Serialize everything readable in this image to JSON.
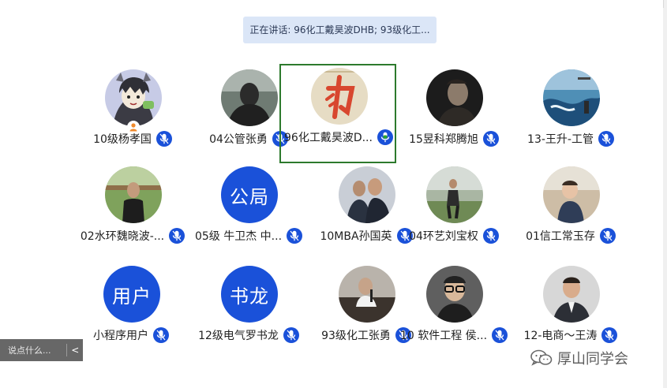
{
  "banner": {
    "text": "正在讲话: 96化工戴昊波DHB; 93级化工..."
  },
  "participants": [
    {
      "name": "10级杨孝国",
      "avatar": "cartoon",
      "host": true
    },
    {
      "name": "04公管张勇",
      "avatar": "photo-dark"
    },
    {
      "name": "96化工戴昊波D...",
      "avatar": "calligraphy",
      "speaking": true
    },
    {
      "name": "15昱科郑腾旭",
      "avatar": "photo-man"
    },
    {
      "name": "13-王升-工管",
      "avatar": "photo-sea"
    },
    {
      "name": "02水环魏晓波-...",
      "avatar": "photo-field"
    },
    {
      "name": "05级 牛卫杰 中...",
      "avatar": "text",
      "avatar_text": "公局"
    },
    {
      "name": "10MBA孙国英",
      "avatar": "photo-people"
    },
    {
      "name": "04环艺刘宝权",
      "avatar": "photo-golf"
    },
    {
      "name": "01信工常玉存",
      "avatar": "photo-child"
    },
    {
      "name": "小程序用户",
      "avatar": "text",
      "avatar_text": "用户"
    },
    {
      "name": "12级电气罗书龙",
      "avatar": "text",
      "avatar_text": "书龙"
    },
    {
      "name": "93级化工张勇",
      "avatar": "photo-speaker"
    },
    {
      "name": "10 软件工程 侯...",
      "avatar": "photo-glasses"
    },
    {
      "name": "12-电商～王涛",
      "avatar": "photo-suit"
    }
  ],
  "chat": {
    "placeholder": "说点什么...",
    "collapse_glyph": "<"
  },
  "watermark": {
    "text": "厚山同学会",
    "icon": "wechat-icon"
  },
  "colors": {
    "accent": "#1a51d9",
    "active_border": "#2d7a2d",
    "speaking_mic": "#2aa52a"
  }
}
